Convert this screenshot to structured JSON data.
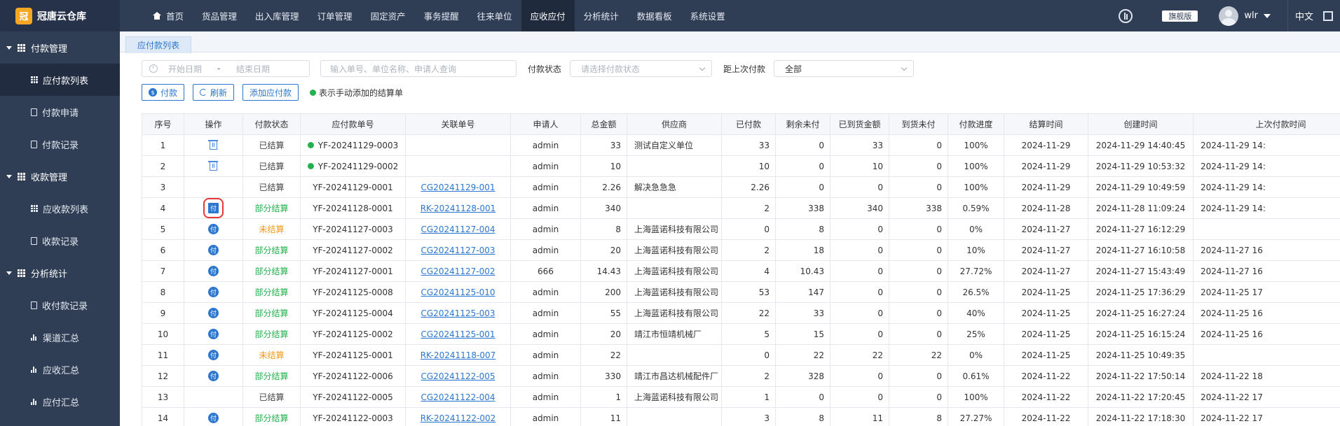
{
  "app": {
    "logo_char": "冠",
    "name": "冠唐云仓库"
  },
  "nav": [
    {
      "label": "首页",
      "home": true
    },
    {
      "label": "货品管理"
    },
    {
      "label": "出入库管理"
    },
    {
      "label": "订单管理"
    },
    {
      "label": "固定资产"
    },
    {
      "label": "事务提醒"
    },
    {
      "label": "往来单位"
    },
    {
      "label": "应收应付",
      "active": true
    },
    {
      "label": "分析统计"
    },
    {
      "label": "数据看板"
    },
    {
      "label": "系统设置"
    }
  ],
  "topright": {
    "badge": "旗舰版",
    "user": "wlr",
    "lang": "中文"
  },
  "sidebar": [
    {
      "type": "group",
      "label": "付款管理"
    },
    {
      "type": "item",
      "label": "应付款列表",
      "icon": "grid",
      "active": true
    },
    {
      "type": "item",
      "label": "付款申请",
      "icon": "doc"
    },
    {
      "type": "item",
      "label": "付款记录",
      "icon": "doc"
    },
    {
      "type": "group",
      "label": "收款管理"
    },
    {
      "type": "item",
      "label": "应收款列表",
      "icon": "grid"
    },
    {
      "type": "item",
      "label": "收款记录",
      "icon": "doc"
    },
    {
      "type": "group",
      "label": "分析统计"
    },
    {
      "type": "item",
      "label": "收付款记录",
      "icon": "doc"
    },
    {
      "type": "item",
      "label": "渠道汇总",
      "icon": "bar"
    },
    {
      "type": "item",
      "label": "应收汇总",
      "icon": "bar"
    },
    {
      "type": "item",
      "label": "应付汇总",
      "icon": "bar"
    }
  ],
  "tab": {
    "label": "应付款列表"
  },
  "filters": {
    "date_start": "开始日期",
    "date_sep": "-",
    "date_end": "结束日期",
    "search_placeholder": "输入单号、单位名称、申请人查询",
    "status_label": "付款状态",
    "status_placeholder": "请选择付款状态",
    "last_label": "距上次付款",
    "last_value": "全部"
  },
  "actions": {
    "pay": "付款",
    "refresh": "刷新",
    "add": "添加应付款",
    "legend": "表示手动添加的结算单"
  },
  "table": {
    "columns": [
      "序号",
      "操作",
      "付款状态",
      "应付款单号",
      "关联单号",
      "申请人",
      "总金额",
      "供应商",
      "已付款",
      "剩余未付",
      "已到货金额",
      "到货未付",
      "付款进度",
      "结算时间",
      "创建时间",
      "上次付款时间"
    ],
    "pay_glyph": "付",
    "rows": [
      {
        "no": "1",
        "op": "trash",
        "status": "已结算",
        "st": "settled",
        "manual": true,
        "code": "YF-20241129-0003",
        "ref": "",
        "applicant": "admin",
        "total": "33",
        "supplier": "测试自定义单位",
        "paid": "33",
        "remain": "0",
        "arrived": "33",
        "arrived_unpaid": "0",
        "progress": "100%",
        "settle": "2024-11-29",
        "created": "2024-11-29 14:40:45",
        "last": "2024-11-29 14:"
      },
      {
        "no": "2",
        "op": "trash",
        "status": "已结算",
        "st": "settled",
        "manual": true,
        "code": "YF-20241129-0002",
        "ref": "",
        "applicant": "admin",
        "total": "10",
        "supplier": "",
        "paid": "10",
        "remain": "0",
        "arrived": "10",
        "arrived_unpaid": "0",
        "progress": "100%",
        "settle": "2024-11-29",
        "created": "2024-11-29 10:53:32",
        "last": "2024-11-29 14:"
      },
      {
        "no": "3",
        "op": "",
        "status": "已结算",
        "st": "settled",
        "manual": false,
        "code": "YF-20241129-0001",
        "ref": "CG20241129-001",
        "applicant": "admin",
        "total": "2.26",
        "supplier": "解决急急急",
        "paid": "2.26",
        "remain": "0",
        "arrived": "0",
        "arrived_unpaid": "0",
        "progress": "100%",
        "settle": "2024-11-29",
        "created": "2024-11-29 10:49:59",
        "last": "2024-11-29 14:"
      },
      {
        "no": "4",
        "op": "pay",
        "highlight": true,
        "status": "部分结算",
        "st": "partial",
        "manual": false,
        "code": "YF-20241128-0001",
        "ref": "RK-20241128-001",
        "applicant": "admin",
        "total": "340",
        "supplier": "",
        "paid": "2",
        "remain": "338",
        "arrived": "340",
        "arrived_unpaid": "338",
        "progress": "0.59%",
        "settle": "2024-11-28",
        "created": "2024-11-28 11:09:24",
        "last": "2024-11-29 14:"
      },
      {
        "no": "5",
        "op": "pay",
        "status": "未结算",
        "st": "unpaid",
        "manual": false,
        "code": "YF-20241127-0003",
        "ref": "CG20241127-004",
        "applicant": "admin",
        "total": "8",
        "supplier": "上海蓝诺科技有限公司",
        "paid": "0",
        "remain": "8",
        "arrived": "0",
        "arrived_unpaid": "0",
        "progress": "0%",
        "settle": "2024-11-27",
        "created": "2024-11-27 16:12:29",
        "last": ""
      },
      {
        "no": "6",
        "op": "pay",
        "status": "部分结算",
        "st": "partial",
        "manual": false,
        "code": "YF-20241127-0002",
        "ref": "CG20241127-003",
        "applicant": "admin",
        "total": "20",
        "supplier": "上海蓝诺科技有限公司",
        "paid": "2",
        "remain": "18",
        "arrived": "0",
        "arrived_unpaid": "0",
        "progress": "10%",
        "settle": "2024-11-27",
        "created": "2024-11-27 16:10:58",
        "last": "2024-11-27 16"
      },
      {
        "no": "7",
        "op": "pay",
        "status": "部分结算",
        "st": "partial",
        "manual": false,
        "code": "YF-20241127-0001",
        "ref": "CG20241127-002",
        "applicant": "666",
        "total": "14.43",
        "supplier": "上海蓝诺科技有限公司",
        "paid": "4",
        "remain": "10.43",
        "arrived": "0",
        "arrived_unpaid": "0",
        "progress": "27.72%",
        "settle": "2024-11-27",
        "created": "2024-11-27 15:43:49",
        "last": "2024-11-27 16"
      },
      {
        "no": "8",
        "op": "pay",
        "status": "部分结算",
        "st": "partial",
        "manual": false,
        "code": "YF-20241125-0008",
        "ref": "CG20241125-010",
        "applicant": "admin",
        "total": "200",
        "supplier": "上海蓝诺科技有限公司",
        "paid": "53",
        "remain": "147",
        "arrived": "0",
        "arrived_unpaid": "0",
        "progress": "26.5%",
        "settle": "2024-11-25",
        "created": "2024-11-25 17:36:29",
        "last": "2024-11-25 17"
      },
      {
        "no": "9",
        "op": "pay",
        "status": "部分结算",
        "st": "partial",
        "manual": false,
        "code": "YF-20241125-0004",
        "ref": "CG20241125-003",
        "applicant": "admin",
        "total": "55",
        "supplier": "上海蓝诺科技有限公司",
        "paid": "22",
        "remain": "33",
        "arrived": "0",
        "arrived_unpaid": "0",
        "progress": "40%",
        "settle": "2024-11-25",
        "created": "2024-11-25 16:27:24",
        "last": "2024-11-25 16"
      },
      {
        "no": "10",
        "op": "pay",
        "status": "部分结算",
        "st": "partial",
        "manual": false,
        "code": "YF-20241125-0002",
        "ref": "CG20241125-001",
        "applicant": "admin",
        "total": "20",
        "supplier": "靖江市恒靖机械厂",
        "paid": "5",
        "remain": "15",
        "arrived": "0",
        "arrived_unpaid": "0",
        "progress": "25%",
        "settle": "2024-11-25",
        "created": "2024-11-25 16:15:24",
        "last": "2024-11-25 16"
      },
      {
        "no": "11",
        "op": "pay",
        "status": "未结算",
        "st": "unpaid",
        "manual": false,
        "code": "YF-20241125-0001",
        "ref": "RK-20241118-007",
        "applicant": "admin",
        "total": "22",
        "supplier": "",
        "paid": "0",
        "remain": "22",
        "arrived": "22",
        "arrived_unpaid": "22",
        "progress": "0%",
        "settle": "2024-11-25",
        "created": "2024-11-25 10:49:35",
        "last": ""
      },
      {
        "no": "12",
        "op": "pay",
        "status": "部分结算",
        "st": "partial",
        "manual": false,
        "code": "YF-20241122-0006",
        "ref": "CG20241122-005",
        "applicant": "admin",
        "total": "330",
        "supplier": "靖江市昌达机械配件厂",
        "paid": "2",
        "remain": "328",
        "arrived": "0",
        "arrived_unpaid": "0",
        "progress": "0.61%",
        "settle": "2024-11-22",
        "created": "2024-11-22 17:50:14",
        "last": "2024-11-22 18"
      },
      {
        "no": "13",
        "op": "",
        "status": "已结算",
        "st": "settled",
        "manual": false,
        "code": "YF-20241122-0005",
        "ref": "CG20241122-004",
        "applicant": "admin",
        "total": "1",
        "supplier": "上海蓝诺科技有限公司",
        "paid": "1",
        "remain": "0",
        "arrived": "0",
        "arrived_unpaid": "0",
        "progress": "100%",
        "settle": "2024-11-22",
        "created": "2024-11-22 17:20:45",
        "last": "2024-11-22 17"
      },
      {
        "no": "14",
        "op": "pay",
        "status": "部分结算",
        "st": "partial",
        "manual": false,
        "code": "YF-20241122-0003",
        "ref": "RK-20241122-002",
        "applicant": "admin",
        "total": "11",
        "supplier": "",
        "paid": "3",
        "remain": "8",
        "arrived": "11",
        "arrived_unpaid": "8",
        "progress": "27.27%",
        "settle": "2024-11-22",
        "created": "2024-11-22 17:18:30",
        "last": "2024-11-22 17"
      }
    ]
  }
}
